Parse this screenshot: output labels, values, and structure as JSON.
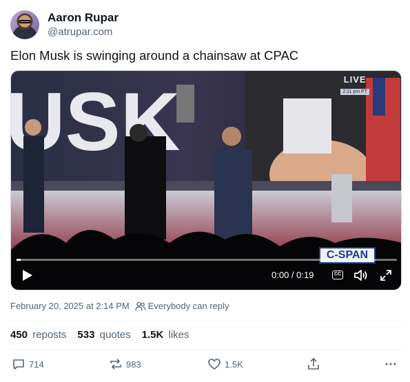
{
  "author": {
    "name": "Aaron Rupar",
    "handle": "@atrupar.com"
  },
  "post": {
    "text": "Elon Musk is swinging around a chainsaw at CPAC"
  },
  "video": {
    "live_label": "LIVE",
    "live_time": "2:11 pm PT",
    "network_logo": "C-SPAN",
    "banner_text": "USK",
    "time_display": "0:00 / 0:19",
    "progress": 0.0,
    "cc_label": "CC"
  },
  "meta": {
    "timestamp": "February 20, 2025 at 2:14 PM",
    "reply_setting": "Everybody can reply"
  },
  "stats": {
    "reposts_count": "450",
    "reposts_label": "reposts",
    "quotes_count": "533",
    "quotes_label": "quotes",
    "likes_count": "1.5K",
    "likes_label": "likes"
  },
  "actions": {
    "reply_count": "714",
    "repost_count": "983",
    "like_count": "1.5K"
  },
  "icons": [
    "avatar",
    "play-icon",
    "closed-captions-icon",
    "volume-icon",
    "fullscreen-icon",
    "people-icon",
    "reply-icon",
    "repost-icon",
    "like-icon",
    "share-icon",
    "more-icon"
  ],
  "colors": {
    "text_primary": "#0f1419",
    "text_secondary": "#536471",
    "divider": "#eff3f4"
  }
}
